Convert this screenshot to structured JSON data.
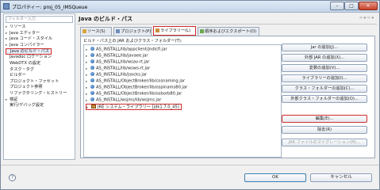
{
  "window": {
    "title": "プロパティー: proj_05_IMSQueue",
    "minimize": "–",
    "maximize": "□",
    "close": "✕"
  },
  "left": {
    "filter_placeholder": "フィルター入力",
    "tree": [
      {
        "label": "リソース",
        "expand": "▸",
        "indent": 1
      },
      {
        "label": "Java エディター",
        "expand": "▸",
        "indent": 1
      },
      {
        "label": "Java コード・スタイル",
        "expand": "▸",
        "indent": 1
      },
      {
        "label": "Java コンパイラー",
        "expand": "▸",
        "indent": 1
      },
      {
        "label": "Java のビルド・パス",
        "expand": "",
        "indent": 1,
        "selected": true
      },
      {
        "label": "Javadoc ロケーション",
        "expand": "",
        "indent": 1
      },
      {
        "label": "WebDTX の設定",
        "expand": "",
        "indent": 1
      },
      {
        "label": "タスク・タグ",
        "expand": "",
        "indent": 1
      },
      {
        "label": "ビルダー",
        "expand": "",
        "indent": 1
      },
      {
        "label": "プロジェクト・ファセット",
        "expand": "",
        "indent": 1
      },
      {
        "label": "プロジェクト参照",
        "expand": "",
        "indent": 1
      },
      {
        "label": "リファクタリング・ヒストリー",
        "expand": "",
        "indent": 1
      },
      {
        "label": "検証",
        "expand": "▸",
        "indent": 1
      },
      {
        "label": "実行/デバッグ設定",
        "expand": "",
        "indent": 1
      }
    ]
  },
  "right": {
    "title": "Java のビルド・パス",
    "nav_icons": "⇦ ▾ ⇨ ▾",
    "tabs": [
      {
        "label": "ソース(S)",
        "active": false,
        "color": "#d9a441"
      },
      {
        "label": "プロジェクト(P)",
        "active": false,
        "color": "#6e8fbf"
      },
      {
        "label": "ライブラリー(L)",
        "active": true,
        "color": "#c88d3a"
      },
      {
        "label": "順序およびエクスポート(O)",
        "active": false,
        "color": "#6aa84f"
      }
    ],
    "list_label": "ビルド・パス上の JAR およびクラス・フォルダー(T):",
    "libraries": [
      {
        "expand": "▸",
        "label": "AS_INSTALL/lib/appclient/jndicfi.jar",
        "type": "jar"
      },
      {
        "expand": "▸",
        "label": "AS_INSTALL/lib/javaee.jar",
        "type": "jar"
      },
      {
        "expand": "▸",
        "label": "AS_INSTALL/lib/wsav-rt.jar",
        "type": "jar"
      },
      {
        "expand": "▸",
        "label": "AS_INSTALL/lib/wsws-rt.jar",
        "type": "jar"
      },
      {
        "expand": "▸",
        "label": "AS_INSTALL/lib/jsocks.jar",
        "type": "jar"
      },
      {
        "expand": "▸",
        "label": "AS_INSTALL/ObjectBroker/lib/cosnaming.jar",
        "type": "jar"
      },
      {
        "expand": "▸",
        "label": "AS_INSTALL/ObjectBroker/lib/ospinams80.jar",
        "type": "jar"
      },
      {
        "expand": "▸",
        "label": "AS_INSTALL/ObjectBroker/lib/osborb80.jar",
        "type": "jar"
      },
      {
        "expand": "▸",
        "label": "AS_INSTALL/wsjms/lib/wsjms.jar",
        "type": "jar"
      },
      {
        "expand": "▸",
        "label": "JRE システム・ライブラリー [jdk1.7.0_45]",
        "type": "jre"
      }
    ],
    "buttons": [
      {
        "label": "Jar の追加(J)...",
        "disabled": false,
        "highlight": false
      },
      {
        "label": "外部 JAR の追加(X)...",
        "disabled": false,
        "highlight": false
      },
      {
        "label": "変数の追加(V)...",
        "disabled": false,
        "highlight": false
      },
      {
        "label": "ライブラリーの追加(I)...",
        "disabled": false,
        "highlight": false
      },
      {
        "label": "クラス・フォルダーの追加(C)...",
        "disabled": false,
        "highlight": false
      },
      {
        "label": "外部クラス・フォルダーの追加(O)...",
        "disabled": false,
        "highlight": false
      },
      {
        "label": "編集(E)...",
        "disabled": false,
        "highlight": true
      },
      {
        "label": "除去(R)",
        "disabled": false,
        "highlight": false
      },
      {
        "label": "JAR ファイルのマイグレーション(M)...",
        "disabled": true,
        "highlight": false
      }
    ]
  },
  "footer": {
    "help_icon": "?",
    "ok_label": "OK",
    "cancel_label": "キャンセル"
  },
  "colors": {
    "highlight_border": "#d12b2b",
    "jar_icon": "#2b5f9e",
    "titlebar": "#c5d5e9"
  }
}
